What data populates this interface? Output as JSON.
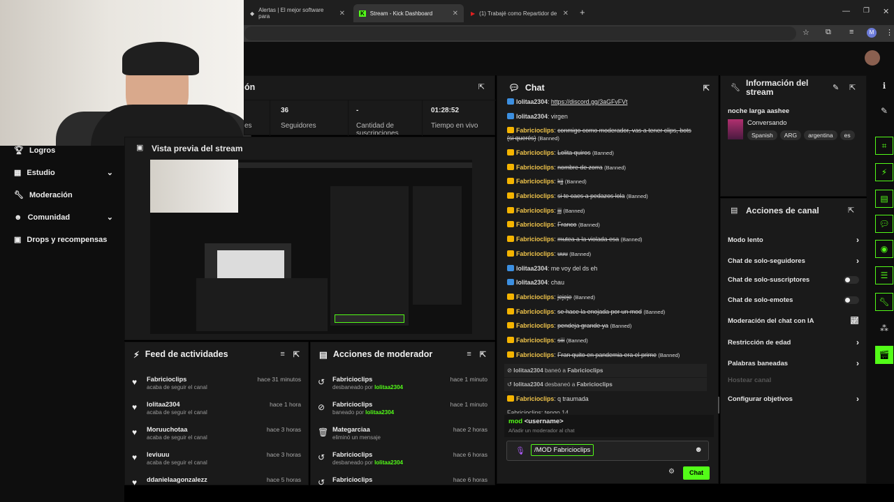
{
  "browser": {
    "tabs": [
      {
        "label": "Alertas | El mejor software para"
      },
      {
        "label": "Stream - Kick Dashboard"
      },
      {
        "label": "(1) Trabajé como Repartidor de"
      }
    ],
    "profile_initial": "M"
  },
  "stats": {
    "title_fragment": "ón",
    "followers_value": "36",
    "followers_label": "Seguidores",
    "viewers_fragment": "es",
    "subs_value": "-",
    "subs_label": "Cantidad de suscripciones",
    "live_value": "01:28:52",
    "live_label": "Tiempo en vivo"
  },
  "preview": {
    "title": "Vista previa del stream"
  },
  "sidebar": {
    "items": [
      {
        "label": "Logros"
      },
      {
        "label": "Estudio"
      },
      {
        "label": "Moderación"
      },
      {
        "label": "Comunidad"
      },
      {
        "label": "Drops y recompensas"
      }
    ]
  },
  "feed": {
    "title": "Feed de actividades",
    "rows": [
      {
        "name": "Fabricioclips",
        "sub": "acaba de seguir el canal",
        "time": "hace 31 minutos"
      },
      {
        "name": "lolitaa2304",
        "sub": "acaba de seguir el canal",
        "time": "hace 1 hora"
      },
      {
        "name": "Moruuchotaa",
        "sub": "acaba de seguir el canal",
        "time": "hace 3 horas"
      },
      {
        "name": "leviuuu",
        "sub": "acaba de seguir el canal",
        "time": "hace 3 horas"
      },
      {
        "name": "ddanielaagonzalezz",
        "sub": "",
        "time": "hace 5 horas"
      }
    ]
  },
  "modactions": {
    "title": "Acciones de moderador",
    "rows": [
      {
        "name": "Fabricioclips",
        "sub": "desbaneado por",
        "by": "lolitaa2304",
        "time": "hace 1 minuto"
      },
      {
        "name": "Fabricioclips",
        "sub": "baneado por",
        "by": "lolitaa2304",
        "time": "hace 1 minuto"
      },
      {
        "name": "Mategarciaa",
        "sub": "eliminó un mensaje",
        "by": "",
        "time": "hace 2 horas"
      },
      {
        "name": "Fabricioclips",
        "sub": "desbaneado por",
        "by": "lolitaa2304",
        "time": "hace 6 horas"
      },
      {
        "name": "Fabricioclips",
        "sub": "",
        "by": "",
        "time": "hace 6 horas"
      }
    ]
  },
  "chat": {
    "title": "Chat",
    "banned_tag": "(Banned)",
    "messages": [
      {
        "user": "lolitaa2304",
        "badge": "mod",
        "text": "https://discord.gg/3aGFvFVt",
        "struck": false,
        "banned": false
      },
      {
        "user": "lolitaa2304",
        "badge": "mod",
        "text": "virgen",
        "struck": false,
        "banned": false
      },
      {
        "user": "Fabricioclips",
        "badge": "vip",
        "text": "conmigo como moderador, vas a tener clips, bots",
        "cont": "(si querés)",
        "struck": true,
        "banned": true
      },
      {
        "user": "Fabricioclips",
        "badge": "vip",
        "text": "Lolita quiros",
        "struck": true,
        "banned": true
      },
      {
        "user": "Fabricioclips",
        "badge": "vip",
        "text": "nombre de zorra",
        "struck": true,
        "banned": true
      },
      {
        "user": "Fabricioclips",
        "badge": "vip",
        "text": "kjj",
        "struck": true,
        "banned": true
      },
      {
        "user": "Fabricioclips",
        "badge": "vip",
        "text": "si te caes a pedazos lola",
        "struck": true,
        "banned": true
      },
      {
        "user": "Fabricioclips",
        "badge": "vip",
        "text": "jjj",
        "struck": true,
        "banned": true
      },
      {
        "user": "Fabricioclips",
        "badge": "vip",
        "text": "Franco",
        "struck": true,
        "banned": true
      },
      {
        "user": "Fabricioclips",
        "badge": "vip",
        "text": "mutea a la violada esa",
        "struck": true,
        "banned": true
      },
      {
        "user": "Fabricioclips",
        "badge": "vip",
        "text": "uuu",
        "struck": true,
        "banned": true
      },
      {
        "user": "lolitaa2304",
        "badge": "mod",
        "text": "me voy del ds eh",
        "struck": false,
        "banned": false
      },
      {
        "user": "lolitaa2304",
        "badge": "mod",
        "text": "chau",
        "struck": false,
        "banned": false
      },
      {
        "user": "Fabricioclips",
        "badge": "vip",
        "text": "jejeje",
        "struck": true,
        "banned": true
      },
      {
        "user": "Fabricioclips",
        "badge": "vip",
        "text": "se hace la enojada por un mod",
        "struck": true,
        "banned": true
      },
      {
        "user": "Fabricioclips",
        "badge": "vip",
        "text": "pendeja grande ya",
        "struck": true,
        "banned": true
      },
      {
        "user": "Fabricioclips",
        "badge": "vip",
        "text": "siii",
        "struck": true,
        "banned": true
      },
      {
        "user": "Fabricioclips",
        "badge": "vip",
        "text": "Fran quito en pandemia era el prime",
        "struck": true,
        "banned": true
      }
    ],
    "system": [
      {
        "user": "lolitaa2304",
        "verb": "baneó a",
        "target": "Fabricioclips"
      },
      {
        "user": "lolitaa2304",
        "verb": "desbaneó a",
        "target": "Fabricioclips"
      }
    ],
    "last_user": "Fabricioclips",
    "last_text": "q traumada",
    "cut_text": "Fabricioclips: tengo 14",
    "suggest_cmd": "mod",
    "suggest_arg": "<username>",
    "suggest_desc": "Añadir un moderador al chat",
    "input_value": "/MOD Fabricioclips",
    "send_label": "Chat"
  },
  "info": {
    "title": "Información del stream",
    "stream_title": "noche larga aashee",
    "category": "Conversando",
    "tags": [
      "Spanish",
      "ARG",
      "argentina",
      "es"
    ]
  },
  "actions": {
    "title": "Acciones de canal",
    "items": [
      {
        "label": "Modo lento",
        "kind": "arrow"
      },
      {
        "label": "Chat de solo-seguidores",
        "kind": "arrow"
      },
      {
        "label": "Chat de solo-suscriptores",
        "kind": "toggle"
      },
      {
        "label": "Chat de solo-emotes",
        "kind": "toggle"
      },
      {
        "label": "Moderación del chat con IA",
        "kind": "chart"
      },
      {
        "label": "Restricción de edad",
        "kind": "arrow"
      },
      {
        "label": "Palabras baneadas",
        "kind": "arrow"
      },
      {
        "label": "Hostear canal",
        "kind": "disabled"
      },
      {
        "label": "Configurar objetivos",
        "kind": "arrow"
      }
    ]
  },
  "colors": {
    "accent": "#53fc18",
    "crown": "#f5b400",
    "panel": "#1a1a1a"
  }
}
